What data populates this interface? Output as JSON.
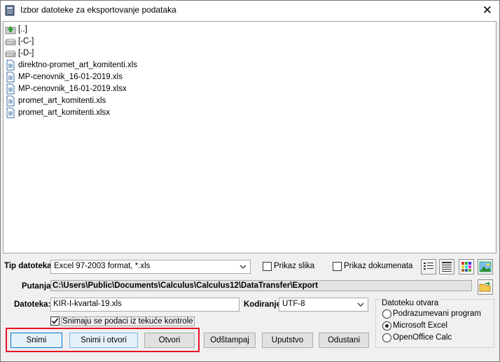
{
  "window": {
    "title": "Izbor datoteke za eksportovanje podataka",
    "close_glyph": "✕"
  },
  "files": [
    {
      "label": "[..]",
      "icon": "folder-up-icon"
    },
    {
      "label": "[-C-]",
      "icon": "drive-icon"
    },
    {
      "label": "[-D-]",
      "icon": "drive-icon"
    },
    {
      "label": "direktno-promet_art_komitenti.xls",
      "icon": "file-icon"
    },
    {
      "label": "MP-cenovnik_16-01-2019.xls",
      "icon": "file-icon"
    },
    {
      "label": "MP-cenovnik_16-01-2019.xlsx",
      "icon": "file-icon"
    },
    {
      "label": "promet_art_komitenti.xls",
      "icon": "file-icon"
    },
    {
      "label": "promet_art_komitenti.xlsx",
      "icon": "file-icon"
    }
  ],
  "tip_datoteka": {
    "label": "Tip datoteka:",
    "value": "Excel 97-2003 format, *.xls"
  },
  "prikaz_slika": {
    "label": "Prikaz slika",
    "checked": false
  },
  "prikaz_dokumenata": {
    "label": "Prikaz dokumenata",
    "checked": false
  },
  "putanja": {
    "label": "Putanja:",
    "value": "C:\\Users\\Public\\Documents\\Calculus\\Calculus12\\DataTransfer\\Export"
  },
  "datoteka": {
    "label": "Datoteka:",
    "value": "KIR-I-kvartal-19.xls"
  },
  "kodiranje": {
    "label": "Kodiranje:",
    "value": "UTF-8"
  },
  "snimaju": {
    "label": "Snimaju se podaci iz tekuće kontrole",
    "checked": true
  },
  "datoteku_otvara": {
    "legend": "Datoteku otvara",
    "options": [
      {
        "label": "Podrazumevani program",
        "selected": false
      },
      {
        "label": "Microsoft Excel",
        "selected": true
      },
      {
        "label": "OpenOffice Calc",
        "selected": false
      }
    ]
  },
  "buttons": {
    "snimi": "Snimi",
    "snimi_otvori": "Snimi i otvori",
    "otvori": "Otvori",
    "odstampaj": "Odštampaj",
    "uputstvo": "Uputstvo",
    "odustani": "Odustani"
  },
  "colors": {
    "highlight": "#e81123",
    "primary_border": "#0078d7"
  }
}
